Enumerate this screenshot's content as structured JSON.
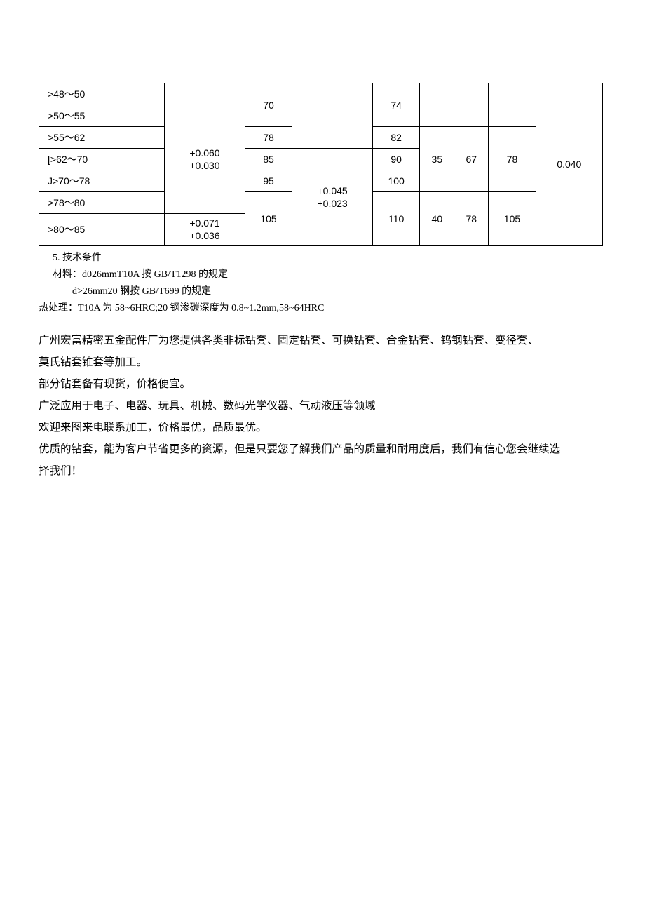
{
  "table": {
    "rows": [
      {
        "range": ">48～50"
      },
      {
        "range": ">50～55"
      },
      {
        "range": ">55～62"
      },
      {
        "range": "[>62～70"
      },
      {
        "range": "J>70～78"
      },
      {
        "range": ">78～80"
      },
      {
        "range": ">80～85"
      }
    ],
    "tol_col2_a": "+0.060\n+0.030",
    "tol_col2_b": "+0.071\n+0.036",
    "col3": {
      "r1": "70",
      "r3": "78",
      "r4": "85",
      "r5": "95",
      "r6": "105"
    },
    "tol_col4": "+0.045\n+0.023",
    "col5": {
      "r1": "74",
      "r3": "82",
      "r4": "90",
      "r5": "100",
      "r6": "110"
    },
    "col6": {
      "a": "35",
      "b": "40"
    },
    "col7": {
      "a": "67",
      "b": "78"
    },
    "col8": {
      "a": "78",
      "b": "105"
    },
    "col9": "0.040"
  },
  "notes": {
    "n1": "5. 技术条件",
    "n2": "材料：d026mmT10A 按 GB/T1298 的规定",
    "n3": "d>26mm20 钢按 GB/T699 的规定",
    "n4": "热处理：T10A 为 58~6HRC;20 钢渗碳深度为 0.8~1.2mm,58~64HRC"
  },
  "body": {
    "p1": "广州宏富精密五金配件厂为您提供各类非标钻套、固定钻套、可换钻套、合金钻套、钨钢钻套、变径套、",
    "p2": "莫氏钻套锥套等加工。",
    "p3": "部分钻套备有现货，价格便宜。",
    "p4": "广泛应用于电子、电器、玩具、机械、数码光学仪器、气动液压等领域",
    "p5": "欢迎来图来电联系加工，价格最优，品质最优。",
    "p6": "优质的钻套，能为客户节省更多的资源，但是只要您了解我们产品的质量和耐用度后，我们有信心您会继续选",
    "p7": "择我们！"
  }
}
